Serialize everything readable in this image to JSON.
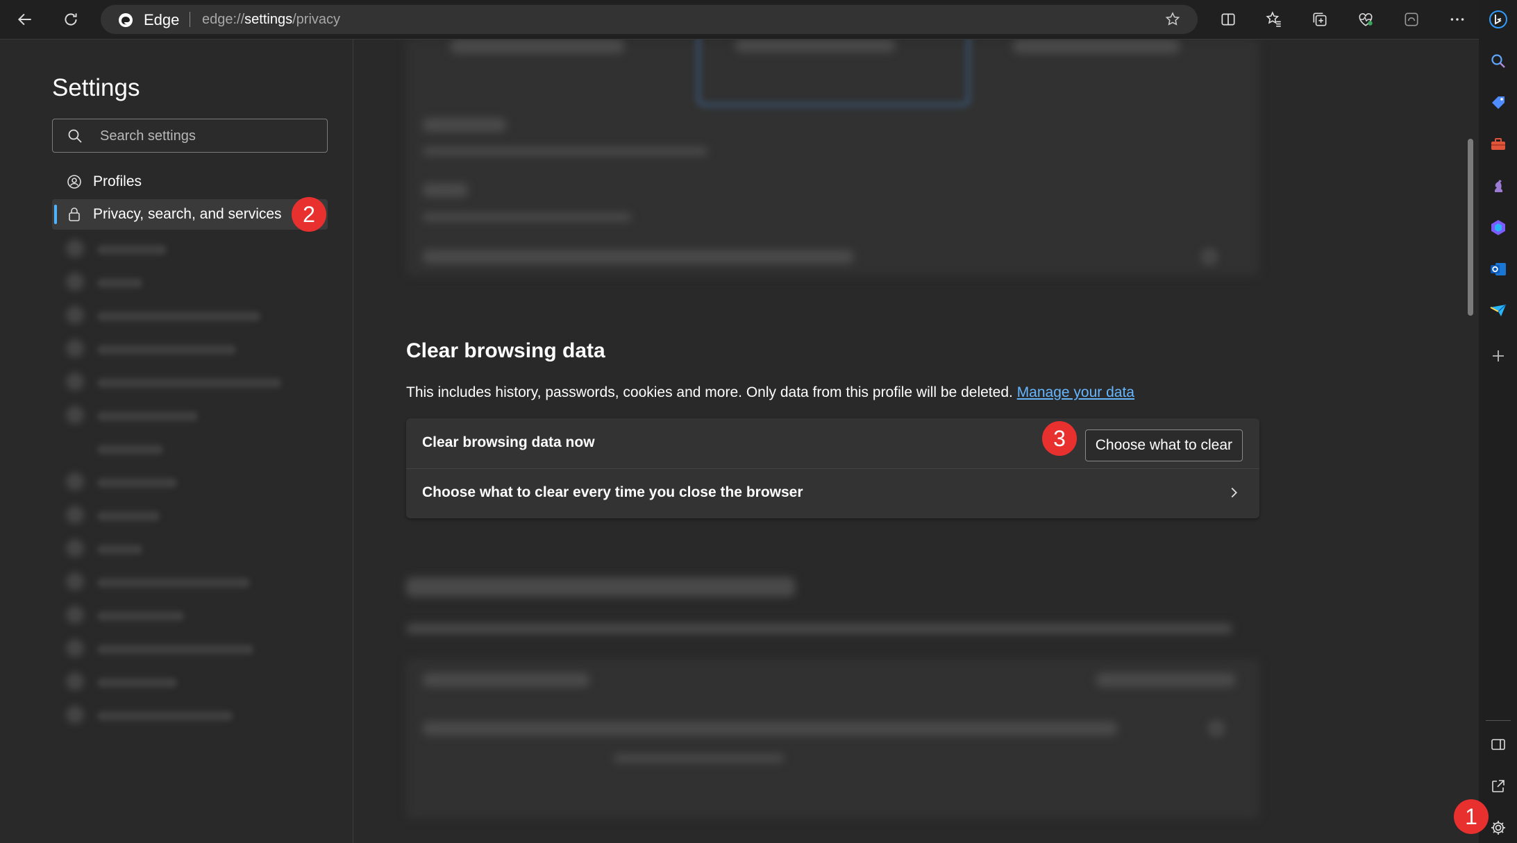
{
  "browser": {
    "site_name": "Edge",
    "url_prefix": "edge://",
    "url_main": "settings",
    "url_suffix": "/privacy"
  },
  "sidebar": {
    "title": "Settings",
    "search_placeholder": "Search settings",
    "items": [
      {
        "label": "Profiles",
        "icon": "profiles-icon"
      },
      {
        "label": "Privacy, search, and services",
        "icon": "lock-icon"
      }
    ]
  },
  "main": {
    "section_title": "Clear browsing data",
    "section_desc": "This includes history, passwords, cookies and more. Only data from this profile will be deleted.",
    "manage_link": "Manage your data",
    "row1_label": "Clear browsing data now",
    "row1_button": "Choose what to clear",
    "row2_label": "Choose what to clear every time you close the browser"
  },
  "annotations": {
    "badge1": "1",
    "badge2": "2",
    "badge3": "3"
  },
  "colors": {
    "accent": "#4fb3ff",
    "link": "#66b6ff",
    "badge": "#e8312f",
    "background": "#292929"
  }
}
